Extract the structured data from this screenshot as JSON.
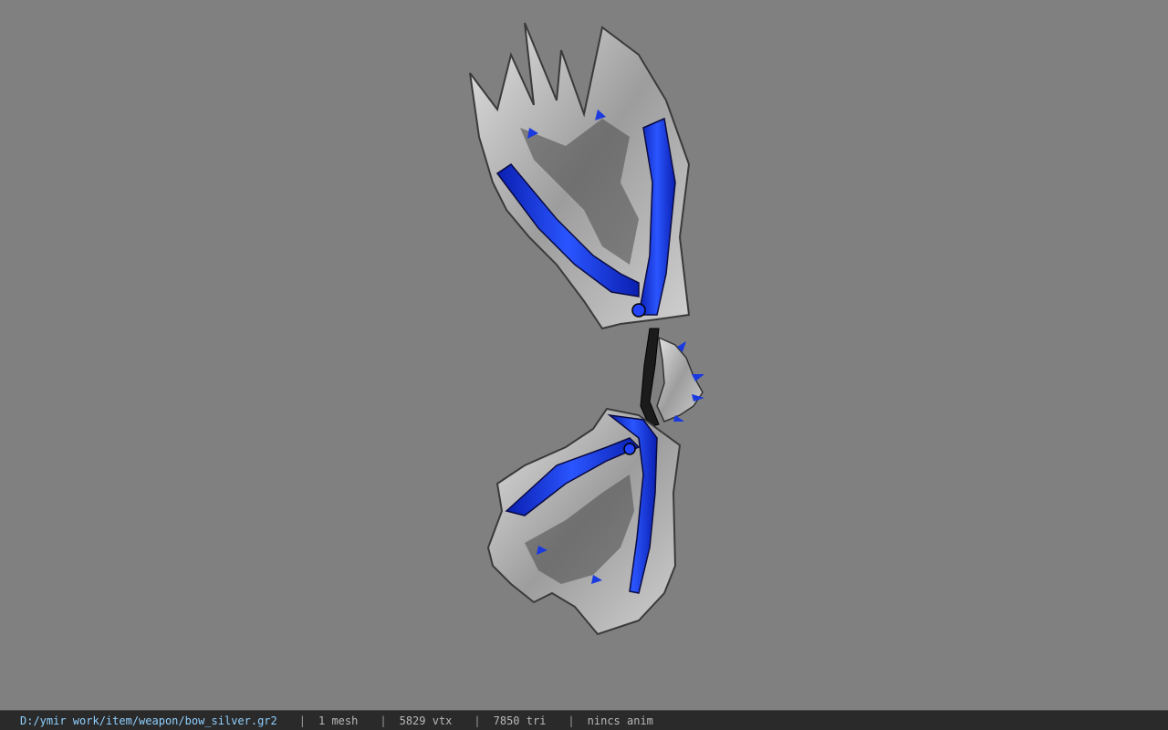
{
  "viewer": {
    "background_color": "#808080",
    "model": {
      "icon": "bow-model",
      "metal_color": "#b8b8b8",
      "accent_color": "#1f3fd8"
    }
  },
  "status_bar": {
    "file_path": "D:/ymir work/item/weapon/bow_silver.gr2",
    "separator": "|",
    "mesh_count": "1 mesh",
    "vertex_count": "5829 vtx",
    "triangle_count": "7850 tri",
    "anim_state": "nincs anim"
  }
}
